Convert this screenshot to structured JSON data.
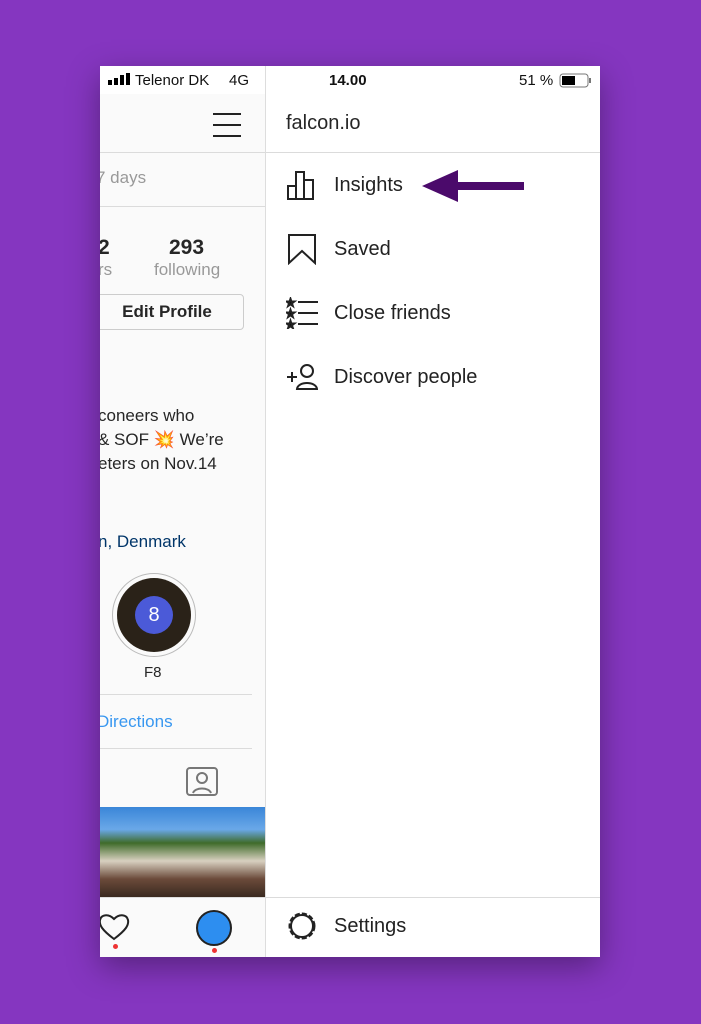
{
  "status_bar": {
    "carrier": "Telenor DK",
    "network": "4G",
    "time": "14.00",
    "battery": "51 %",
    "battery_level": 0.51
  },
  "profile_panel": {
    "range_text": "7 days",
    "followers_count": "2",
    "followers_label": "rs",
    "following_count": "293",
    "following_label": "following",
    "edit_profile": "Edit Profile",
    "bio": [
      "coneers who",
      "& SOF 💥 We’re",
      "eters on Nov.14"
    ],
    "location": "n, Denmark",
    "highlight": {
      "badge": "8",
      "label": "F8"
    },
    "directions": "Directions"
  },
  "menu": {
    "username": "falcon.io",
    "items": [
      {
        "label": "Insights",
        "icon": "bar-chart-icon"
      },
      {
        "label": "Saved",
        "icon": "bookmark-icon"
      },
      {
        "label": "Close friends",
        "icon": "star-list-icon"
      },
      {
        "label": "Discover people",
        "icon": "add-person-icon"
      }
    ],
    "settings": "Settings"
  },
  "colors": {
    "background": "#8536c0",
    "arrow": "#4b0a6b",
    "link": "#3897f0",
    "location": "#003569"
  }
}
